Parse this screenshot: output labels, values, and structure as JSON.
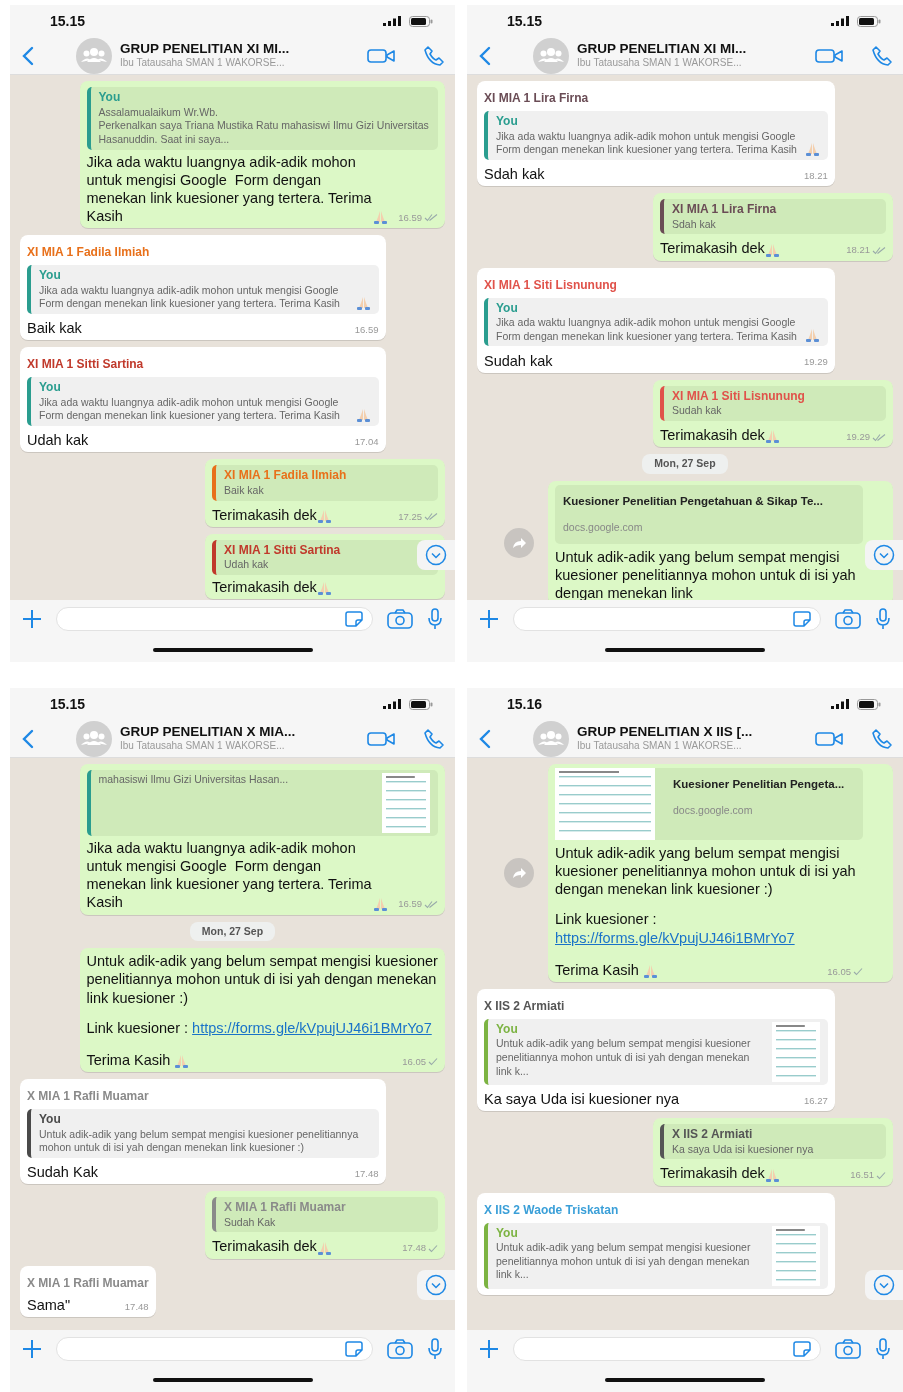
{
  "phones": [
    {
      "status_time": "15.15",
      "title": "GRUP PENELITIAN XI MI...",
      "subtitle": "Ibu Tatausaha SMAN 1 WAKORSE...",
      "messages": [
        {
          "kind": "out",
          "quote": {
            "author": "You",
            "color": "#2a9d8f",
            "text": "Assalamualaikum Wr.Wb.\nPerkenalkan saya Triana Mustika Ratu mahasiswi Ilmu Gizi Universitas Hasanuddin. Saat ini saya..."
          },
          "paragraphs": [
            {
              "text": "Jika ada waktu luangnya adik-adik mohon untuk mengisi Google  Form dengan menekan link kuesioner yang tertera. Terima Kasih",
              "pray": true
            }
          ],
          "time": "16.59",
          "delivered": true
        },
        {
          "kind": "in",
          "sender": "XI MIA 1 Fadila Ilmiah",
          "color": "#e8701a",
          "quote": {
            "author": "You",
            "color": "#2a9d8f",
            "text": "Jika ada waktu luangnya adik-adik mohon untuk mengisi Google  Form dengan menekan link kuesioner yang tertera. Terima Kasih",
            "pray": true
          },
          "paragraphs": [
            {
              "text": "Baik kak"
            }
          ],
          "time": "16.59"
        },
        {
          "kind": "in",
          "sender": "XI MIA 1 Sitti Sartina",
          "color": "#c0392b",
          "quote": {
            "author": "You",
            "color": "#2a9d8f",
            "text": "Jika ada waktu luangnya adik-adik mohon untuk mengisi Google  Form dengan menekan link kuesioner yang tertera. Terima Kasih",
            "pray": true
          },
          "paragraphs": [
            {
              "text": "Udah kak"
            }
          ],
          "time": "17.04"
        },
        {
          "kind": "out",
          "quote": {
            "author": "XI MIA 1 Fadila Ilmiah",
            "color": "#e8701a",
            "text": "Baik kak"
          },
          "paragraphs": [
            {
              "text": "Terimakasih dek",
              "pray": true
            }
          ],
          "time": "17.25",
          "delivered": true
        },
        {
          "kind": "out",
          "quote": {
            "author": "XI MIA 1 Sitti Sartina",
            "color": "#c0392b",
            "text": "Udah kak"
          },
          "paragraphs": [
            {
              "text": "Terimakasih dek",
              "pray": true
            }
          ]
        }
      ]
    },
    {
      "status_time": "15.15",
      "title": "GRUP PENELITIAN XI MI...",
      "subtitle": "Ibu Tatausaha SMAN 1 WAKORSE...",
      "messages": [
        {
          "kind": "in",
          "sender": "XI MIA 1 Lira Firna",
          "color": "#6a4c55",
          "quote": {
            "author": "You",
            "color": "#2a9d8f",
            "text": "Jika ada waktu luangnya adik-adik mohon untuk mengisi Google  Form dengan menekan link kuesioner yang tertera. Terima Kasih",
            "pray": true
          },
          "paragraphs": [
            {
              "text": "Sdah kak"
            }
          ],
          "time": "18.21"
        },
        {
          "kind": "out",
          "quote": {
            "author": "XI MIA 1 Lira Firna",
            "color": "#6a4c55",
            "text": "Sdah kak"
          },
          "paragraphs": [
            {
              "text": "Terimakasih dek",
              "pray": true
            }
          ],
          "time": "18.21",
          "delivered": true
        },
        {
          "kind": "in",
          "sender": "XI MIA 1 Siti Lisnunung",
          "color": "#e0524a",
          "quote": {
            "author": "You",
            "color": "#2a9d8f",
            "text": "Jika ada waktu luangnya adik-adik mohon untuk mengisi Google  Form dengan menekan link kuesioner yang tertera. Terima Kasih",
            "pray": true
          },
          "paragraphs": [
            {
              "text": "Sudah kak"
            }
          ],
          "time": "19.29"
        },
        {
          "kind": "out",
          "quote": {
            "author": "XI MIA 1 Siti Lisnunung",
            "color": "#e0524a",
            "text": "Sudah kak"
          },
          "paragraphs": [
            {
              "text": "Terimakasih dek",
              "pray": true
            }
          ],
          "time": "19.29",
          "delivered": true
        },
        {
          "kind": "date",
          "text": "Mon, 27 Sep"
        },
        {
          "kind": "out",
          "forwardable": true,
          "preview": {
            "title": "Kuesioner Penelitian Pengetahuan & Sikap Te...",
            "domain": "docs.google.com",
            "thumbnail": false
          },
          "paragraphs": [
            {
              "text": "Untuk adik-adik yang belum sempat mengisi kuesioner penelitiannya mohon untuk di isi yah dengan menekan link"
            }
          ]
        }
      ]
    },
    {
      "status_time": "15.15",
      "title": "GRUP PENELITIAN X MIA...",
      "subtitle": "Ibu Tatausaha SMAN 1 WAKORSE...",
      "messages": [
        {
          "kind": "out",
          "quote": {
            "color": "#2a9d8f",
            "text": "mahasiswi Ilmu Gizi Universitas Hasan...",
            "thumbnail": true
          },
          "paragraphs": [
            {
              "text": "Jika ada waktu luangnya adik-adik mohon untuk mengisi Google  Form dengan menekan link kuesioner yang tertera. Terima Kasih",
              "pray": true
            }
          ],
          "time": "16.59",
          "delivered": true
        },
        {
          "kind": "date",
          "text": "Mon, 27 Sep"
        },
        {
          "kind": "out",
          "paragraphs": [
            {
              "text": "Untuk adik-adik yang belum sempat mengisi kuesioner penelitiannya mohon untuk di isi yah dengan menekan link kuesioner :)"
            },
            {
              "text": "Link kuesioner : ",
              "link": "https://forms.gle/kVpujUJ46i1BMrYo7"
            },
            {
              "text": "Terima Kasih ",
              "pray": true
            }
          ],
          "time": "16.05",
          "delivered": false
        },
        {
          "kind": "in",
          "sender": "X MIA 1 Rafli Muamar",
          "color": "#8a8a8a",
          "quote": {
            "author": "You",
            "color": "#4a4a4a",
            "text": "Untuk adik-adik yang belum sempat mengisi kuesioner penelitiannya mohon untuk di isi yah dengan menekan link kuesioner :)"
          },
          "paragraphs": [
            {
              "text": "Sudah Kak"
            }
          ],
          "time": "17.48"
        },
        {
          "kind": "out",
          "quote": {
            "author": "X MIA 1 Rafli Muamar",
            "color": "#8a8a8a",
            "text": "Sudah Kak"
          },
          "paragraphs": [
            {
              "text": "Terimakasih dek",
              "pray": true
            }
          ],
          "time": "17.48",
          "delivered": false
        },
        {
          "kind": "in",
          "sender": "X MIA 1 Rafli Muamar",
          "color": "#8a8a8a",
          "paragraphs": [
            {
              "text": "Sama\""
            }
          ],
          "time": "17.48"
        }
      ]
    },
    {
      "status_time": "15.16",
      "title": "GRUP PENELITIAN X IIS [...",
      "subtitle": "Ibu Tatausaha SMAN 1 WAKORSE...",
      "messages": [
        {
          "kind": "out",
          "forwardable": true,
          "preview": {
            "title": "Kuesioner Penelitian Pengeta...",
            "domain": "docs.google.com",
            "thumbnail": true
          },
          "paragraphs": [
            {
              "text": "Untuk adik-adik yang belum sempat mengisi kuesioner penelitiannya mohon untuk di isi yah dengan menekan link kuesioner :)"
            },
            {
              "text": "Link kuesioner : ",
              "link": "https://forms.gle/kVpujUJ46i1BMrYo7"
            },
            {
              "text": "Terima Kasih ",
              "pray": true
            }
          ],
          "time": "16.05",
          "delivered": false
        },
        {
          "kind": "in",
          "sender": "X IIS 2 Armiati",
          "color": "#555555",
          "quote": {
            "author": "You",
            "color": "#7cb342",
            "text": "Untuk adik-adik yang belum sempat mengisi kuesioner penelitiannya mohon untuk di isi yah dengan menekan link k...",
            "thumbnail": true
          },
          "paragraphs": [
            {
              "text": "Ka saya Uda isi kuesioner nya"
            }
          ],
          "time": "16.27"
        },
        {
          "kind": "out",
          "quote": {
            "author": "X IIS 2 Armiati",
            "color": "#555555",
            "text": "Ka saya Uda isi kuesioner nya"
          },
          "paragraphs": [
            {
              "text": "Terimakasih dek",
              "pray": true
            }
          ],
          "time": "16.51",
          "delivered": false
        },
        {
          "kind": "in",
          "sender": "X IIS 2 Waode Triskatan",
          "color": "#3a9fd8",
          "quote": {
            "author": "You",
            "color": "#7cb342",
            "text": "Untuk adik-adik yang belum sempat mengisi kuesioner penelitiannya mohon untuk di isi yah dengan menekan link k...",
            "thumbnail": true
          }
        }
      ]
    }
  ]
}
